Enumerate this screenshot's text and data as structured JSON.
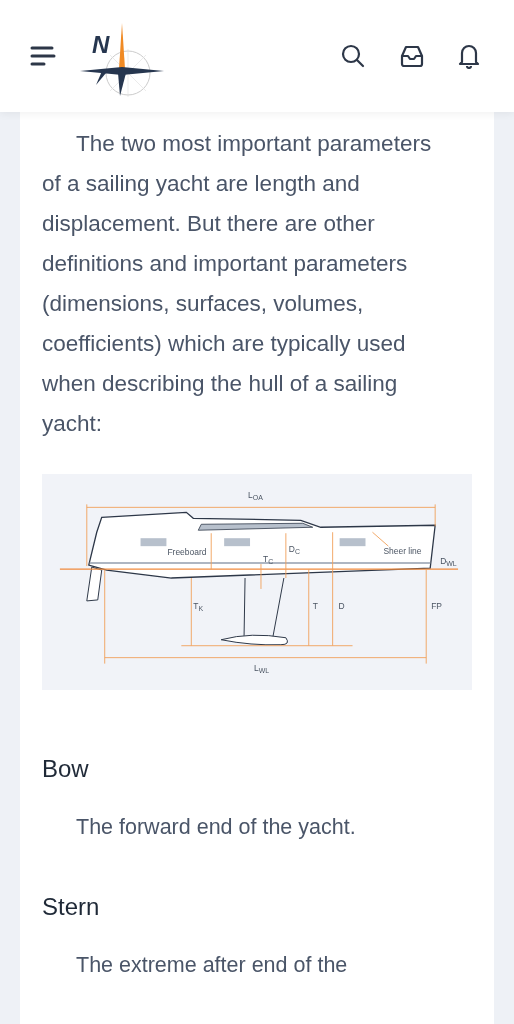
{
  "header": {
    "logo_letter": "N"
  },
  "intro": "The two most important parameters of a sailing yacht are length and displacement. But there are other definitions and important parameters (dimensions, surfaces, volumes, coefficients) which are typically used when describing the hull of a sailing yacht:",
  "diagram": {
    "labels": {
      "loa": "L$_{OA}$",
      "freeboard": "Freeboard",
      "dc": "D$_{C}$",
      "tc": "T$_{C}$",
      "sheer": "Sheer line",
      "dwl": "D$_{WL}$",
      "tk": "T$_{K}$",
      "t": "T",
      "d": "D",
      "fp": "FP",
      "lwl": "L$_{WL}$"
    }
  },
  "terms": [
    {
      "term": "Bow",
      "definition": "The forward end of the yacht."
    },
    {
      "term": "Stern",
      "definition": "The extreme after end of the"
    }
  ]
}
